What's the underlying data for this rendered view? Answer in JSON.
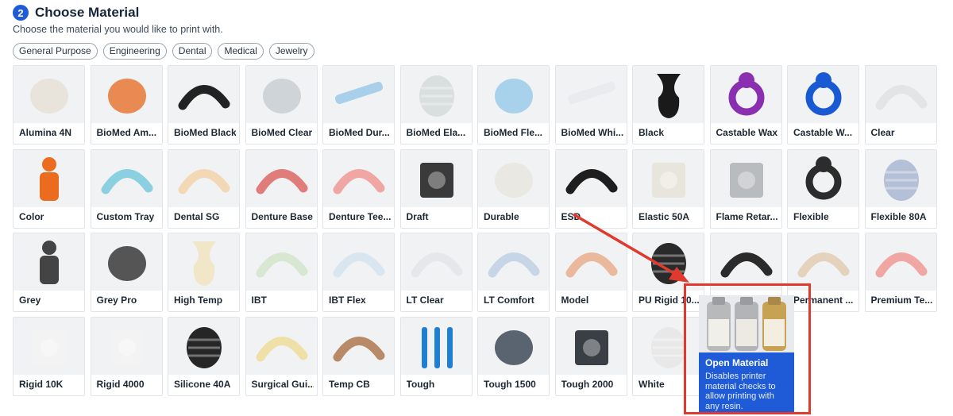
{
  "header": {
    "step_number": "2",
    "title": "Choose Material",
    "subtitle": "Choose the material you would like to print with."
  },
  "filters": [
    "General Purpose",
    "Engineering",
    "Dental",
    "Medical",
    "Jewelry"
  ],
  "materials": [
    "Alumina 4N",
    "BioMed Am...",
    "BioMed Black",
    "BioMed Clear",
    "BioMed Dur...",
    "BioMed Ela...",
    "BioMed Fle...",
    "BioMed Whi...",
    "Black",
    "Castable Wax",
    "Castable W...",
    "Clear",
    "Color",
    "Custom Tray",
    "Dental SG",
    "Denture Base",
    "Denture Tee...",
    "Draft",
    "Durable",
    "ESD",
    "Elastic 50A",
    "Flame Retar...",
    "Flexible",
    "Flexible 80A",
    "Grey",
    "Grey Pro",
    "High Temp",
    "IBT",
    "IBT Flex",
    "LT Clear",
    "LT Comfort",
    "Model",
    "PU Rigid 10...",
    "",
    "Permanent ...",
    "Premium Te...",
    "Rigid 10K",
    "Rigid 4000",
    "Silicone 40A",
    "Surgical Gui...",
    "Temp CB",
    "Tough",
    "Tough 1500",
    "Tough 2000",
    "White"
  ],
  "open_material": {
    "title": "Open Material",
    "description": "Disables printer material checks to allow printing with any resin."
  },
  "colors": {
    "accent": "#1f5bd7",
    "callout": "#e03a2e"
  }
}
